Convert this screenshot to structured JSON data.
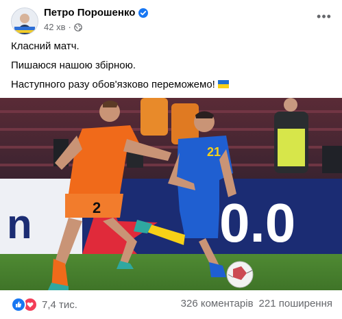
{
  "post": {
    "author": "Петро Порошенко",
    "time": "42 хв",
    "lines": [
      "Класний матч.",
      "Пишаюся нашою збірною.",
      "Наступного разу обов'язково переможемо!"
    ]
  },
  "photo": {
    "jersey_numbers": [
      "21",
      "2"
    ],
    "ad_board_text": "0.0"
  },
  "footer": {
    "reactions_count": "7,4 тис.",
    "comments": "326 коментарів",
    "shares": "221 поширення"
  },
  "colors": {
    "accent": "#1877f2",
    "love": "#f33e58",
    "netherlands": "#f06a1a",
    "ukraine": "#1f5fd1"
  }
}
